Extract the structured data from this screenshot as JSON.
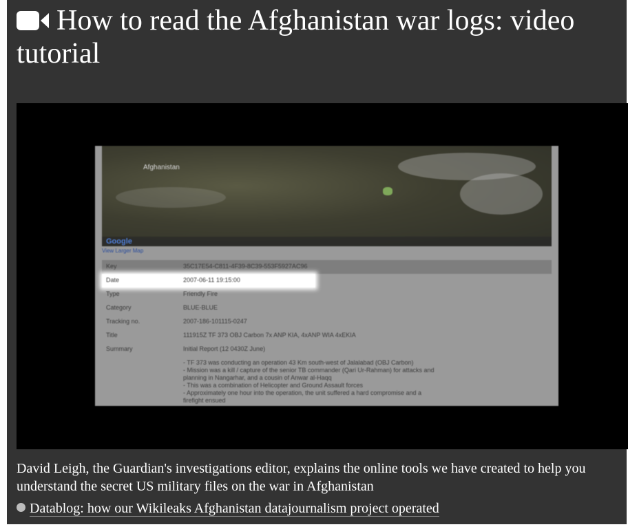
{
  "header": {
    "title": "How to read the Afghanistan war logs: video tutorial",
    "icon": "video-camera-icon"
  },
  "video": {
    "map": {
      "label": "Afghanistan",
      "logo": "Google",
      "larger_map_link": "View Larger Map"
    },
    "log_table": [
      {
        "key": "Key",
        "value": "35C17E54-C811-4F39-8C39-553F5927AC96"
      },
      {
        "key": "Date",
        "value": "2007-06-11 19:15:00"
      },
      {
        "key": "Type",
        "value": "Friendly Fire"
      },
      {
        "key": "Category",
        "value": "BLUE-BLUE"
      },
      {
        "key": "Tracking no.",
        "value": "2007-186-101115-0247"
      },
      {
        "key": "Title",
        "value": "111915Z TF 373 OBJ Carbon 7x ANP KIA, 4xANP WIA 4xEKIA"
      },
      {
        "key": "Summary",
        "value": "Initial Report (12 0430Z June)"
      }
    ],
    "summary_lines": [
      "- TF 373 was conducting an operation 43 Km south-west of Jalalabad (OBJ Carbon)",
      "- Mission was a kill / capture of the senior TB commander (Qari Ur-Rahman) for attacks and",
      "planning in Nangarhar, and a cousin of Anwar al-Haqq",
      "- This was a combination of Helicopter and Ground Assault forces",
      "- Approximately one hour into the operation, the unit suffered a hard compromise and a",
      "firefight ensued"
    ]
  },
  "caption": "David Leigh, the Guardian's investigations editor, explains the online tools we have created to help you understand the secret US military files on the war in Afghanistan",
  "related_link": "Datablog: how our Wikileaks Afghanistan datajournalism project operated",
  "colors": {
    "panel": "#333333",
    "player": "#000000",
    "text": "#ffffff",
    "bullet": "#bdbdbd"
  }
}
